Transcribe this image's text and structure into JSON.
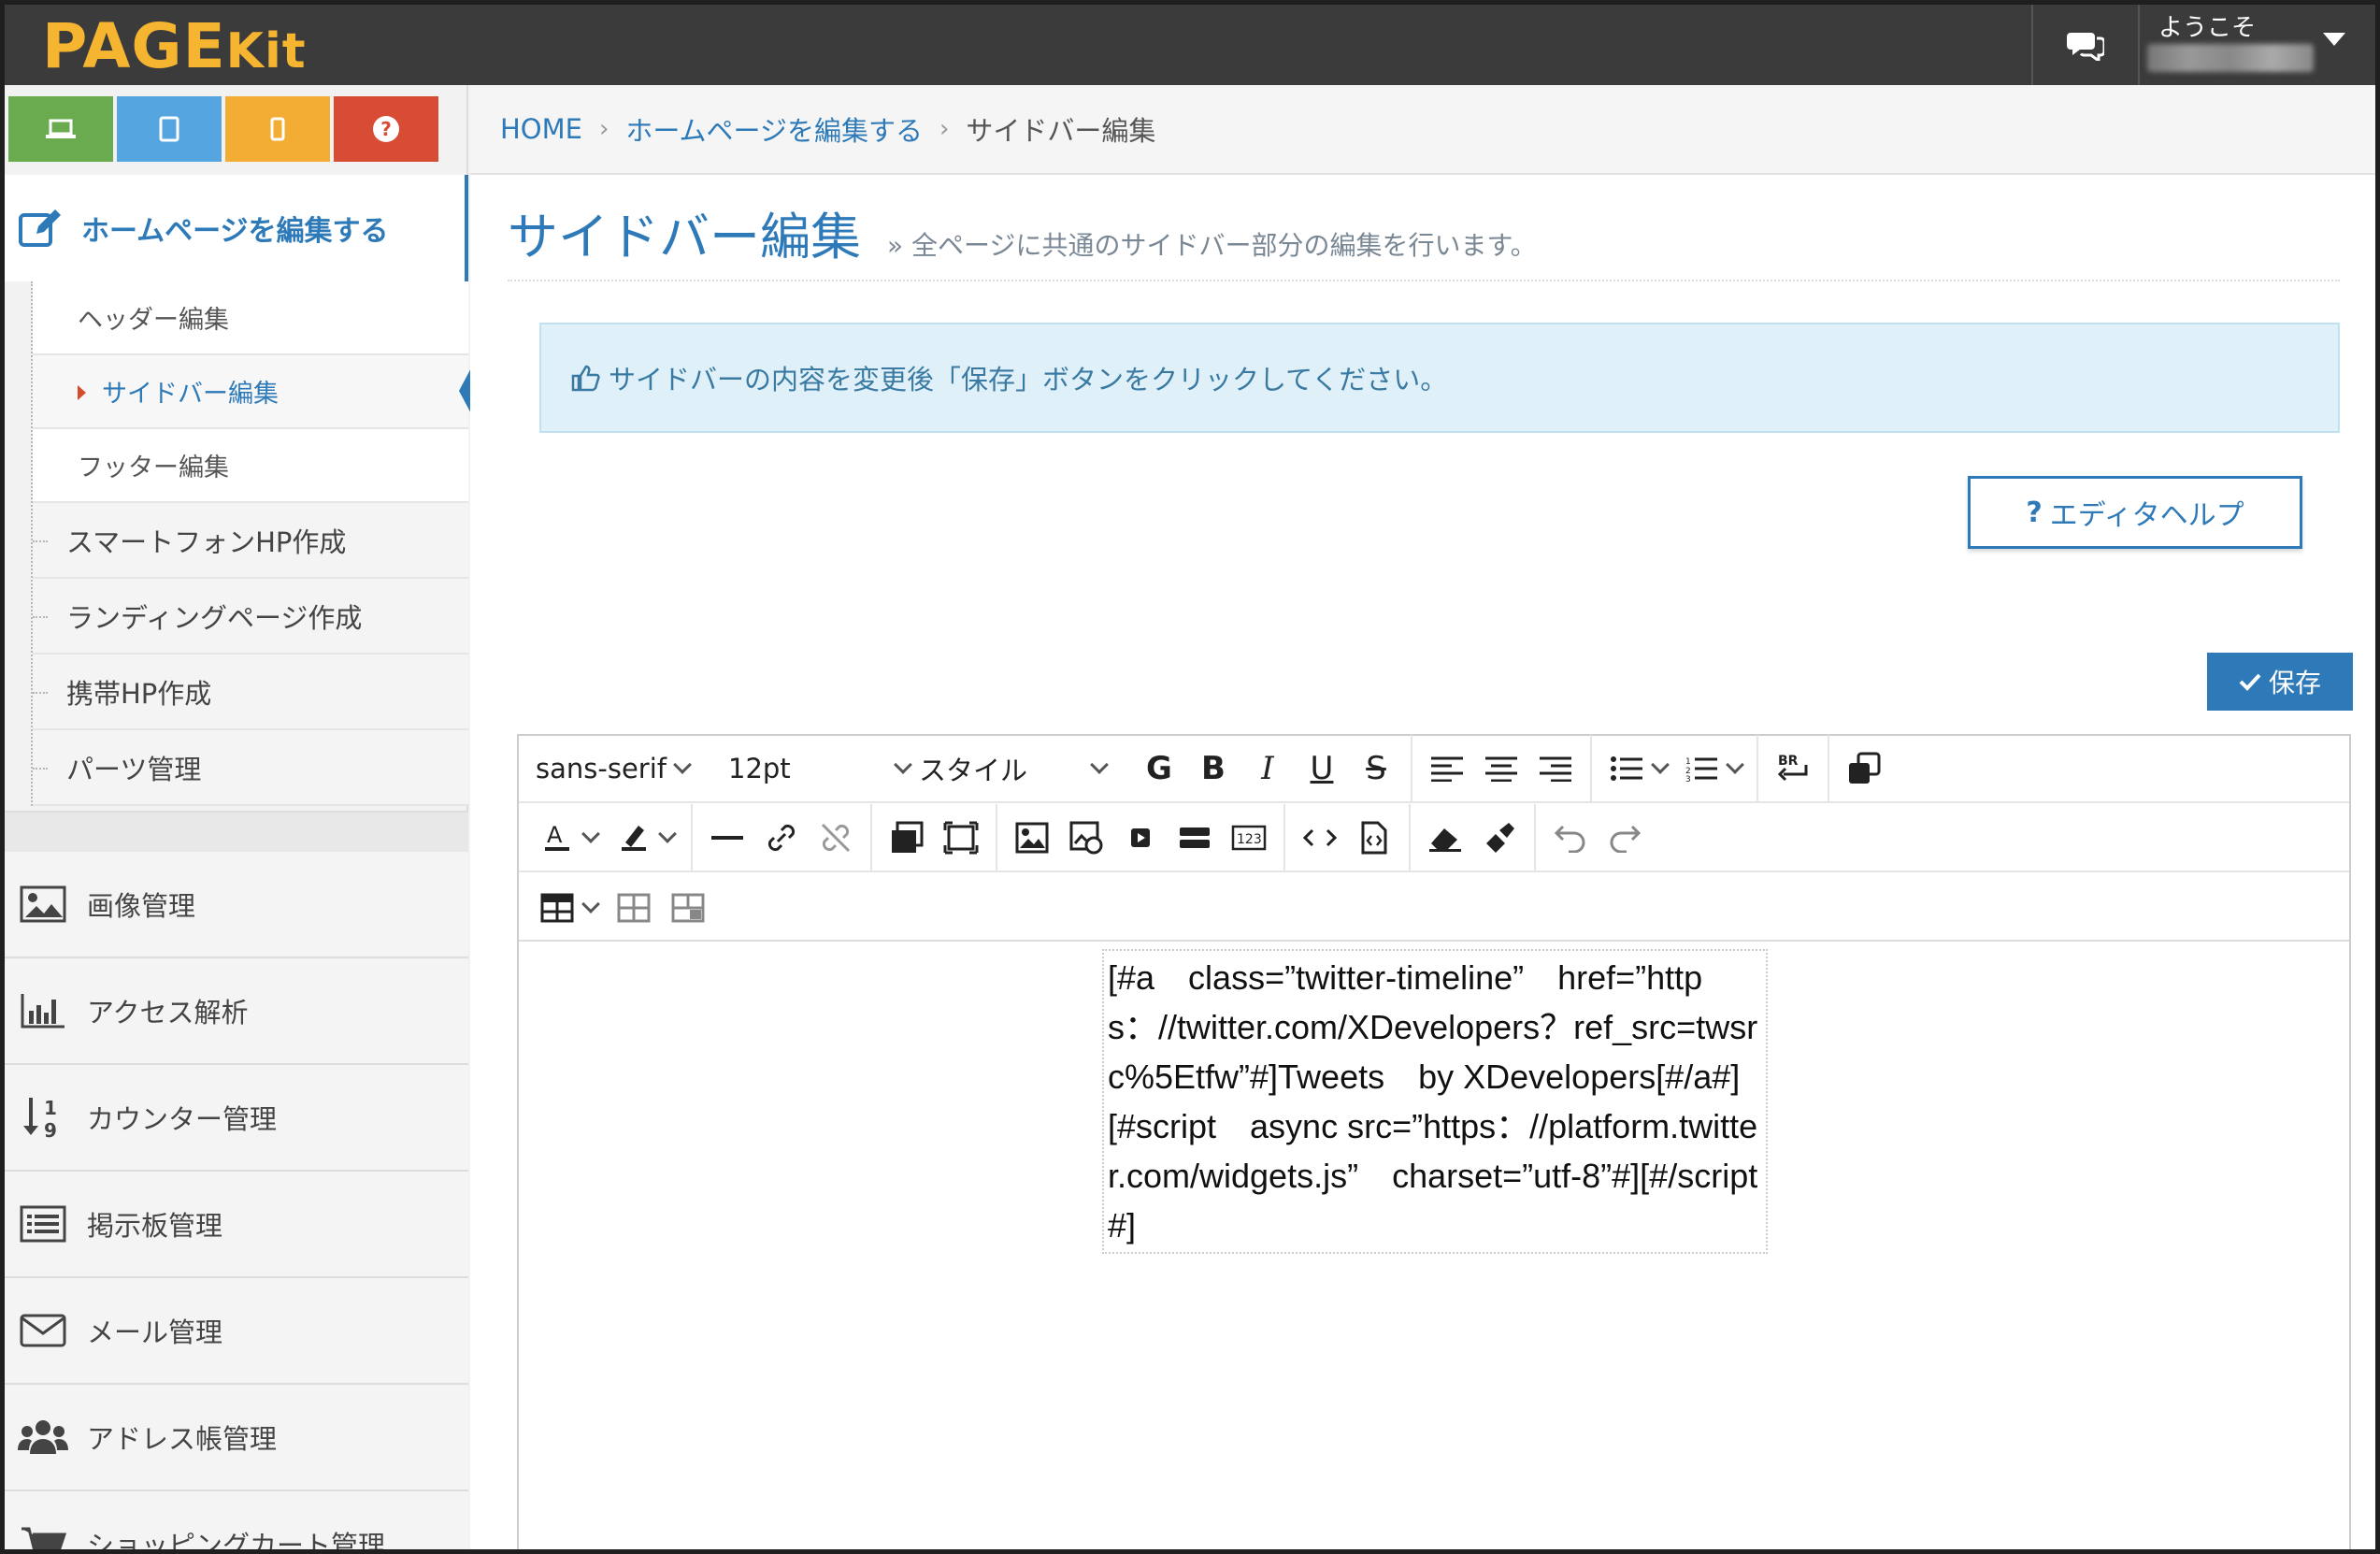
{
  "header": {
    "logo_main": "PAGE",
    "logo_kit": "Kit",
    "user_greeting": "ようこそ"
  },
  "device_buttons": [
    {
      "name": "pc",
      "color": "#6aab4f"
    },
    {
      "name": "tablet",
      "color": "#55a6e0"
    },
    {
      "name": "smartphone",
      "color": "#f3ad35"
    },
    {
      "name": "help",
      "color": "#d84c35"
    }
  ],
  "sidebar": {
    "active_section": "ホームページを編集する",
    "sub_items": [
      {
        "label": "ヘッダー編集"
      },
      {
        "label": "サイドバー編集"
      },
      {
        "label": "フッター編集"
      }
    ],
    "level1_items": [
      {
        "label": "スマートフォンHP作成"
      },
      {
        "label": "ランディングページ作成"
      },
      {
        "label": "携帯HP作成"
      },
      {
        "label": "パーツ管理"
      }
    ],
    "main_items": [
      {
        "label": "画像管理",
        "icon": "image-icon"
      },
      {
        "label": "アクセス解析",
        "icon": "bar-chart-icon"
      },
      {
        "label": "カウンター管理",
        "icon": "sort-numeric-icon"
      },
      {
        "label": "掲示板管理",
        "icon": "list-board-icon"
      },
      {
        "label": "メール管理",
        "icon": "envelope-icon"
      },
      {
        "label": "アドレス帳管理",
        "icon": "users-icon"
      },
      {
        "label": "ショッピングカート管理",
        "icon": "cart-icon"
      }
    ]
  },
  "breadcrumb": {
    "home": "HOME",
    "parent": "ホームページを編集する",
    "current": "サイドバー編集"
  },
  "page": {
    "title": "サイドバー編集",
    "subtitle": "» 全ページに共通のサイドバー部分の編集を行います。",
    "alert": "サイドバーの内容を変更後「保存」ボタンをクリックしてください。",
    "help_button": "エディタヘルプ",
    "save_button": "保存"
  },
  "editor": {
    "font_family": "sans-serif",
    "font_size": "12pt",
    "style_label": "スタイル",
    "content": "[#a　class=”twitter-timeline”　href=”https：//twitter.com/XDevelopers？ref_src=twsrc%5Etfw”#]Tweets　by XDevelopers[#/a#]　[#script　async src=”https：//platform.twitter.com/widgets.js”　charset=”utf-8”#][#/script#]"
  },
  "colors": {
    "accent": "#2e7ab8",
    "topbar": "#3b3b3b",
    "logo": "#f6b530"
  }
}
